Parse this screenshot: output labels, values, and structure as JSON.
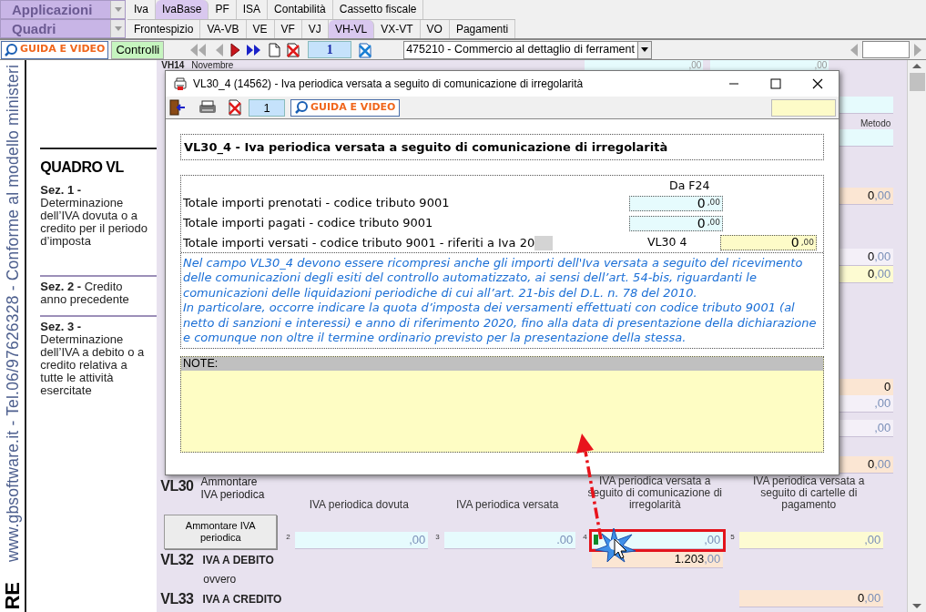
{
  "menus": [
    {
      "label": "Applicazioni"
    },
    {
      "label": "Quadri"
    }
  ],
  "top_tabs": [
    {
      "label": "Iva",
      "selected": false
    },
    {
      "label": "IvaBase",
      "selected": true
    },
    {
      "label": "PF",
      "selected": false
    },
    {
      "label": "ISA",
      "selected": false
    },
    {
      "label": "Contabilità",
      "selected": false
    },
    {
      "label": "Cassetto fiscale",
      "selected": false
    }
  ],
  "section_tabs": [
    {
      "label": "Frontespizio",
      "selected": false
    },
    {
      "label": "VA-VB",
      "selected": false
    },
    {
      "label": "VE",
      "selected": false
    },
    {
      "label": "VF",
      "selected": false
    },
    {
      "label": "VJ",
      "selected": false
    },
    {
      "label": "VH-VL",
      "selected": true
    },
    {
      "label": "VX-VT",
      "selected": false
    },
    {
      "label": "VO",
      "selected": false
    },
    {
      "label": "Pagamenti",
      "selected": false
    }
  ],
  "toolbar": {
    "guide_button": "GUIDA E VIDEO",
    "controls_button": "Controlli",
    "page": "1",
    "activity": "475210 - Commercio al dettaglio di ferrament"
  },
  "side_banner": {
    "text": "www.gbsoftware.it - Tel.06/97626328 - Conforme al modello ministeri",
    "bottom": "RE"
  },
  "quadro": {
    "title": "QUADRO VL",
    "sections": [
      {
        "text": "**Sez. 1 -** Determinazione dell’IVA dovuta o a credito per il periodo d’imposta"
      },
      {
        "text": "**Sez. 2 -** Credito anno precedente"
      },
      {
        "text": "**Sez. 3 -** Determinazione dell’IVA a debito o a credito relativa a tutte le attività esercitate"
      }
    ]
  },
  "form_top": {
    "code": "VH14",
    "label": "Novembre",
    "values": [
      {
        "decimals": ",00"
      },
      {
        "decimals": ",00"
      }
    ]
  },
  "right_fields": [
    {
      "kind": "input"
    },
    {
      "kind": "label",
      "text": "Metodo"
    },
    {
      "kind": "input"
    },
    {
      "kind": "total",
      "integer": "0",
      "decimals": ",00"
    },
    {
      "kind": "plain",
      "integer": "0",
      "decimals": ",00"
    },
    {
      "kind": "yellow",
      "integer": "0",
      "decimals": ",00"
    },
    {
      "kind": "total",
      "integer": "0"
    },
    {
      "kind": "plain",
      "decimals": ",00"
    },
    {
      "kind": "plain",
      "decimals": ",00"
    },
    {
      "kind": "total",
      "integer": "0",
      "decimals": ",00"
    }
  ],
  "dialog": {
    "title": "VL30_4 (14562) - Iva periodica versata a seguito di comunicazione di irregolarità",
    "page": "1",
    "guide_button": "GUIDA E VIDEO",
    "heading": "VL30_4 - Iva periodica versata a seguito di comunicazione di irregolarità",
    "column_header": "Da F24",
    "rows": [
      {
        "label": "Totale importi prenotati - codice tributo 9001",
        "kind": "input",
        "integer": "0",
        "decimals": ",00"
      },
      {
        "label": "Totale importi pagati - codice tributo 9001",
        "kind": "input",
        "integer": "0",
        "decimals": ",00"
      },
      {
        "label": "Totale importi versati - codice tributo 9001 - riferiti a Iva 20",
        "code": "VL30 4",
        "kind": "result",
        "integer": "0",
        "decimals": ",00"
      }
    ],
    "info": [
      "Nel campo VL30_4 devono essere ricompresi anche gli importi dell'Iva versata a seguito del ricevimento delle comunicazioni degli esiti del controllo automatizzato, ai sensi dell’art. 54-bis, riguardanti le comunicazioni delle liquidazioni periodiche di cui all’art. 21-bis del D.L. n. 78 del 2010.",
      "In particolare, occorre indicare la quota d’imposta dei versamenti effettuati con codice tributo 9001 (al netto di sanzioni e interessi) e anno di riferimento 2020, fino alla data di presentazione della dichiarazione e comunque non oltre il termine ordinario previsto per la presentazione della stessa."
    ],
    "note_label": "NOTE:"
  },
  "vl30": {
    "code": "VL30",
    "label": "Ammontare IVA periodica",
    "button": "Ammontare IVA periodica",
    "columns": [
      {
        "number": "2",
        "header": "IVA periodica dovuta",
        "kind": "input",
        "decimals": ",00",
        "highlighted": false
      },
      {
        "number": "3",
        "header": "IVA periodica versata",
        "kind": "input",
        "decimals": ".00",
        "highlighted": false
      },
      {
        "number": "4",
        "header": "IVA periodica versata a seguito di comunicazione di irregolarità",
        "kind": "input",
        "decimals": ",00",
        "highlighted": true
      },
      {
        "number": "5",
        "header": "IVA periodica versata a seguito di cartelle di pagamento",
        "kind": "yellow",
        "decimals": ",00",
        "highlighted": false
      }
    ]
  },
  "vl32": {
    "code": "VL32",
    "label": "IVA A DEBITO",
    "integer": "1.203",
    "decimals": ",00"
  },
  "ovvero": "ovvero",
  "vl33": {
    "code": "VL33",
    "label": "IVA A CREDITO",
    "integer": "0",
    "decimals": ",00"
  }
}
